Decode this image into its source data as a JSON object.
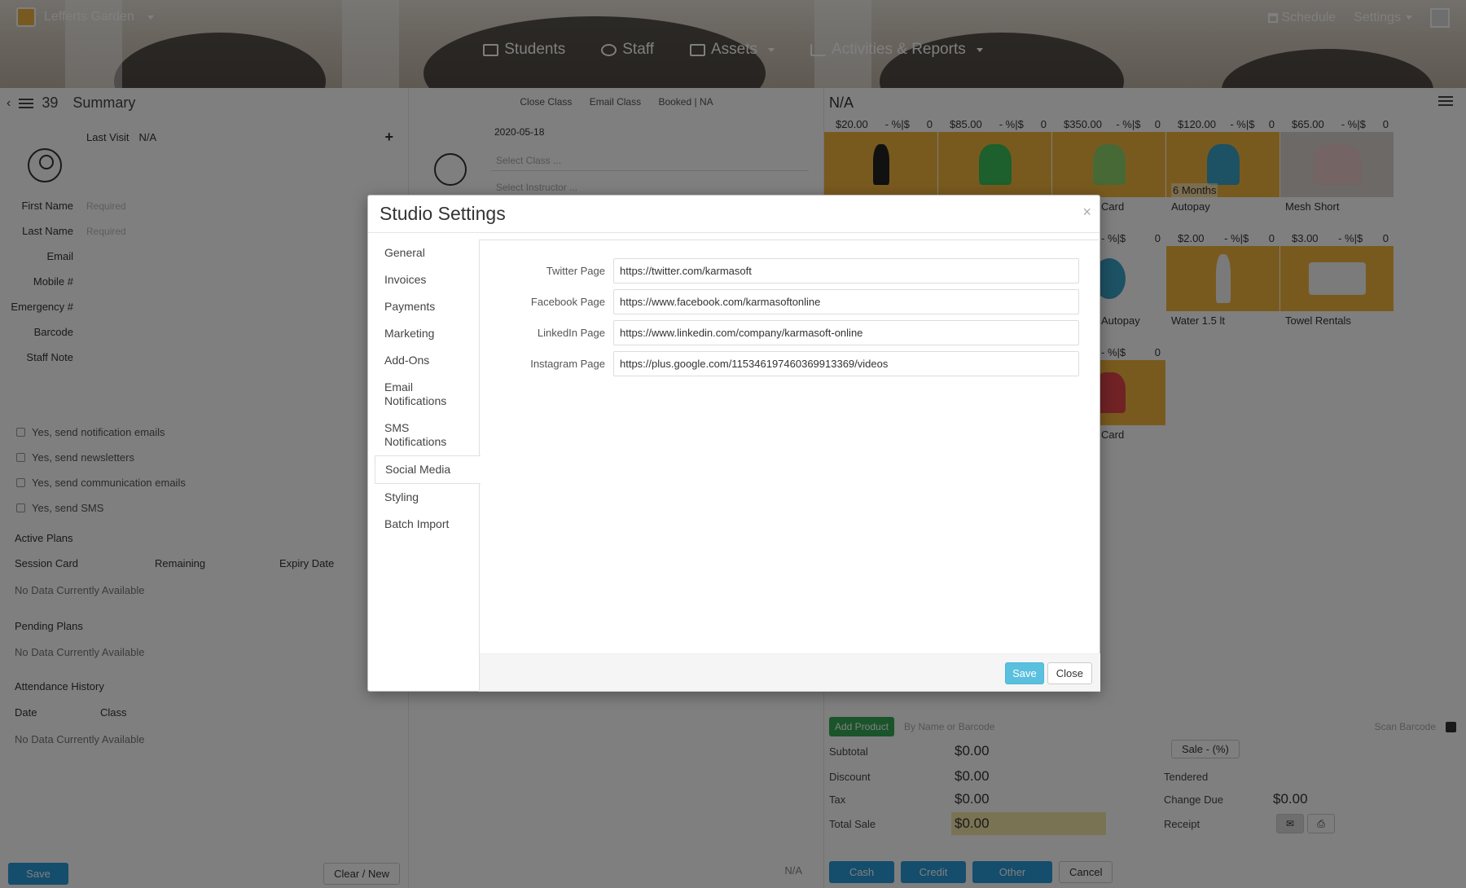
{
  "header": {
    "brand": "Lefferts Garden",
    "nav": [
      {
        "label": "Students",
        "icon": "students-icon"
      },
      {
        "label": "Staff",
        "icon": "staff-icon"
      },
      {
        "label": "Assets",
        "icon": "assets-icon"
      },
      {
        "label": "Activities & Reports",
        "icon": "chart-icon"
      }
    ],
    "schedule": "Schedule",
    "settings": "Settings"
  },
  "left": {
    "count": "39",
    "title": "Summary",
    "last_visit_label": "Last Visit",
    "last_visit_value": "N/A",
    "fields": [
      "First Name",
      "Last Name",
      "Email",
      "Mobile #",
      "Emergency #",
      "Barcode",
      "Staff Note"
    ],
    "required_placeholder": "Required",
    "checks": [
      "Yes, send notification emails",
      "Yes, send newsletters",
      "Yes, send communication emails",
      "Yes, send SMS"
    ],
    "active_plans": "Active Plans",
    "plan_cols": [
      "Session Card",
      "Remaining",
      "Expiry Date"
    ],
    "no_data": "No Data Currently Available",
    "pending_plans": "Pending Plans",
    "attendance": "Attendance History",
    "att_cols": [
      "Date",
      "Class"
    ],
    "save": "Save",
    "clear": "Clear / New"
  },
  "mid": {
    "links": [
      "Close Class",
      "Email Class",
      "Booked | NA"
    ],
    "date": "2020-05-18",
    "select_class": "Select Class ...",
    "select_instructor": "Select Instructor ...",
    "footer": "N/A"
  },
  "right": {
    "title": "N/A",
    "tiles": [
      {
        "price": "$20.00",
        "disc": "- %|$",
        "qty": "0",
        "caption": ""
      },
      {
        "price": "$85.00",
        "disc": "- %|$",
        "qty": "0",
        "caption": ""
      },
      {
        "price": "$350.00",
        "disc": "- %|$",
        "qty": "0",
        "caption": "Card"
      },
      {
        "price": "$120.00",
        "disc": "- %|$",
        "qty": "0",
        "caption": "Autopay",
        "sub": "6 Months"
      },
      {
        "price": "$65.00",
        "disc": "- %|$",
        "qty": "0",
        "caption": "Mesh Short"
      },
      {
        "price": "",
        "disc": "- %|$",
        "qty": "0",
        "caption": "Autopay"
      },
      {
        "price": "$2.00",
        "disc": "- %|$",
        "qty": "0",
        "caption": "Water 1.5 lt"
      },
      {
        "price": "$3.00",
        "disc": "- %|$",
        "qty": "0",
        "caption": "Towel Rentals"
      },
      {
        "price": "",
        "disc": "- %|$",
        "qty": "0",
        "caption": "Card"
      }
    ],
    "add_product": "Add Product",
    "search_placeholder": "By Name or Barcode",
    "scan": "Scan Barcode",
    "subtotal_label": "Subtotal",
    "subtotal": "$0.00",
    "discount_label": "Discount",
    "discount": "$0.00",
    "tax_label": "Tax",
    "tax": "$0.00",
    "total_label": "Total Sale",
    "total": "$0.00",
    "sale_btn": "Sale - (%)",
    "tendered_label": "Tendered",
    "change_label": "Change Due",
    "change": "$0.00",
    "receipt_label": "Receipt",
    "pay": [
      "Cash",
      "Credit",
      "Other"
    ],
    "cancel": "Cancel"
  },
  "modal": {
    "title": "Studio Settings",
    "close_x": "×",
    "nav": [
      "General",
      "Invoices",
      "Payments",
      "Marketing",
      "Add-Ons",
      "Email Notifications",
      "SMS Notifications",
      "Social Media",
      "Styling",
      "Batch Import"
    ],
    "active_nav": "Social Media",
    "fields": [
      {
        "label": "Twitter Page",
        "value": "https://twitter.com/karmasoft"
      },
      {
        "label": "Facebook Page",
        "value": "https://www.facebook.com/karmasoftonline"
      },
      {
        "label": "LinkedIn Page",
        "value": "https://www.linkedin.com/company/karmasoft-online"
      },
      {
        "label": "Instagram Page",
        "value": "https://plus.google.com/115346197460369913369/videos"
      }
    ],
    "save": "Save",
    "close": "Close"
  },
  "colors": {
    "primary": "#2a9ad8",
    "save_modal": "#5bc0de",
    "tile_bg": "#f3b43c",
    "add_product": "#35a855"
  }
}
